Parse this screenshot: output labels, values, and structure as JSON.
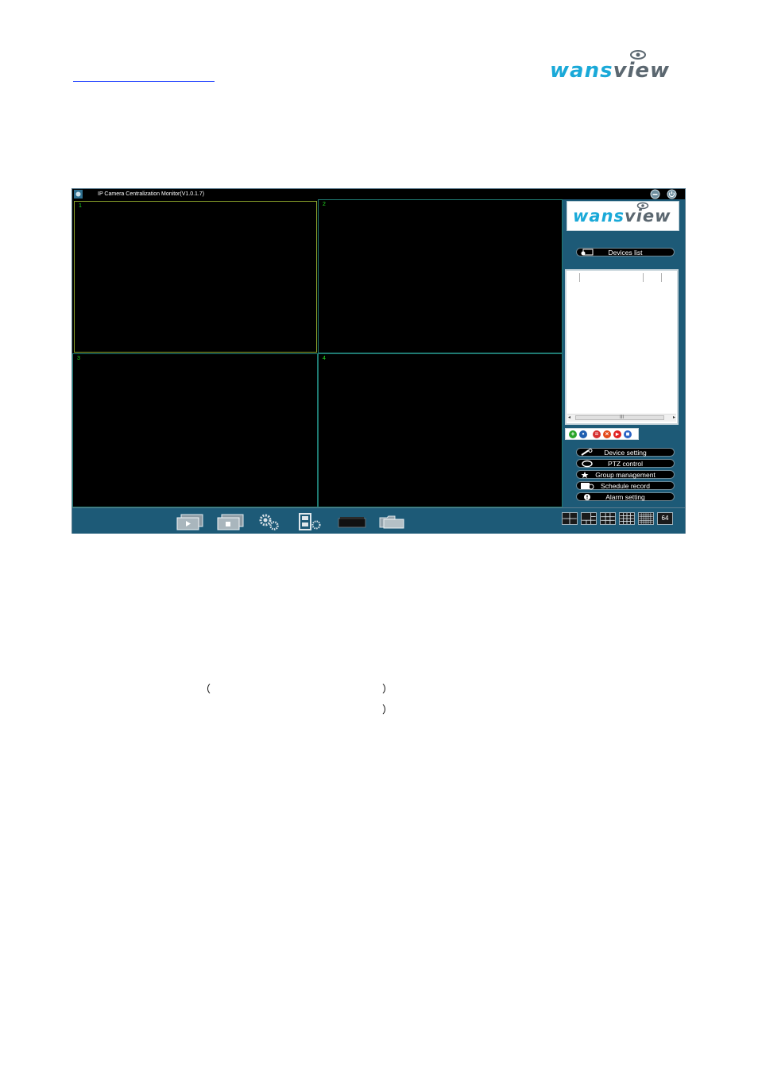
{
  "header": {
    "logo_part1": "wans",
    "logo_part2": "view"
  },
  "window": {
    "title": "IP Camera Centralization Monitor(V1.0.1.7)"
  },
  "panes": [
    {
      "num": "1",
      "selected": true
    },
    {
      "num": "2",
      "selected": false
    },
    {
      "num": "3",
      "selected": false
    },
    {
      "num": "4",
      "selected": false
    }
  ],
  "side": {
    "logo_part1": "wans",
    "logo_part2": "view",
    "devices_list": "Devices list",
    "scroll_grip": "III",
    "buttons": {
      "device_setting": "Device setting",
      "ptz_control": "PTZ control",
      "group_management": "Group management",
      "schedule_record": "Schedule record",
      "alarm_setting": "Alarm setting"
    }
  },
  "layouts": {
    "sixtyfour": "64"
  },
  "body_text": {
    "paren_open": "（",
    "paren_close_1": "）",
    "paren_close_2": "）"
  },
  "colors": {
    "accent": "#1aa9d8",
    "panel": "#1d5a77",
    "pane_number": "#22dd22",
    "selected_pane": "#8aa32b"
  }
}
